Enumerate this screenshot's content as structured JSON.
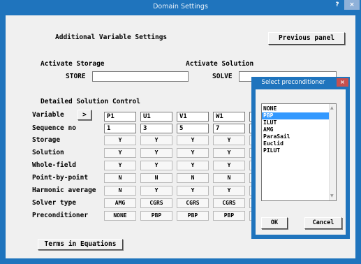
{
  "window": {
    "title": "Domain Settings",
    "help_label": "?",
    "close_label": "×"
  },
  "header": {
    "section_title": "Additional Variable Settings",
    "previous_panel": "Previous panel"
  },
  "activate": {
    "storage_title": "Activate Storage",
    "store_label": "STORE",
    "store_value": "",
    "solution_title": "Activate Solution",
    "solve_label": "SOLVE",
    "solve_value": ""
  },
  "detail": {
    "title": "Detailed Solution Control",
    "variable_label": "Variable",
    "next_button": ">",
    "rows": [
      {
        "label": "Sequence no"
      },
      {
        "label": "Storage"
      },
      {
        "label": "Solution"
      },
      {
        "label": "Whole-field"
      },
      {
        "label": "Point-by-point"
      },
      {
        "label": "Harmonic average"
      },
      {
        "label": "Solver type"
      },
      {
        "label": "Preconditioner"
      }
    ],
    "columns": [
      {
        "variable": "P1",
        "values": [
          "1",
          "Y",
          "Y",
          "Y",
          "N",
          "N",
          "AMG",
          "NONE"
        ]
      },
      {
        "variable": "U1",
        "values": [
          "3",
          "Y",
          "Y",
          "Y",
          "N",
          "Y",
          "CGRS",
          "PBP"
        ]
      },
      {
        "variable": "V1",
        "values": [
          "5",
          "Y",
          "Y",
          "Y",
          "N",
          "Y",
          "CGRS",
          "PBP"
        ]
      },
      {
        "variable": "W1",
        "values": [
          "7",
          "Y",
          "Y",
          "Y",
          "N",
          "Y",
          "CGRS",
          "PBP"
        ]
      },
      {
        "variable": "T",
        "values": [
          "1",
          "",
          "",
          "",
          "",
          "",
          "",
          ""
        ]
      }
    ]
  },
  "footer": {
    "terms_button": "Terms in Equations"
  },
  "dialog": {
    "title": "Select preconditioner",
    "close_label": "×",
    "options": [
      "NONE",
      "PBP",
      "ILUT",
      "AMG",
      "ParaSail",
      "Euclid",
      "PILUT"
    ],
    "selected": "PBP",
    "ok_label": "OK",
    "cancel_label": "Cancel"
  }
}
